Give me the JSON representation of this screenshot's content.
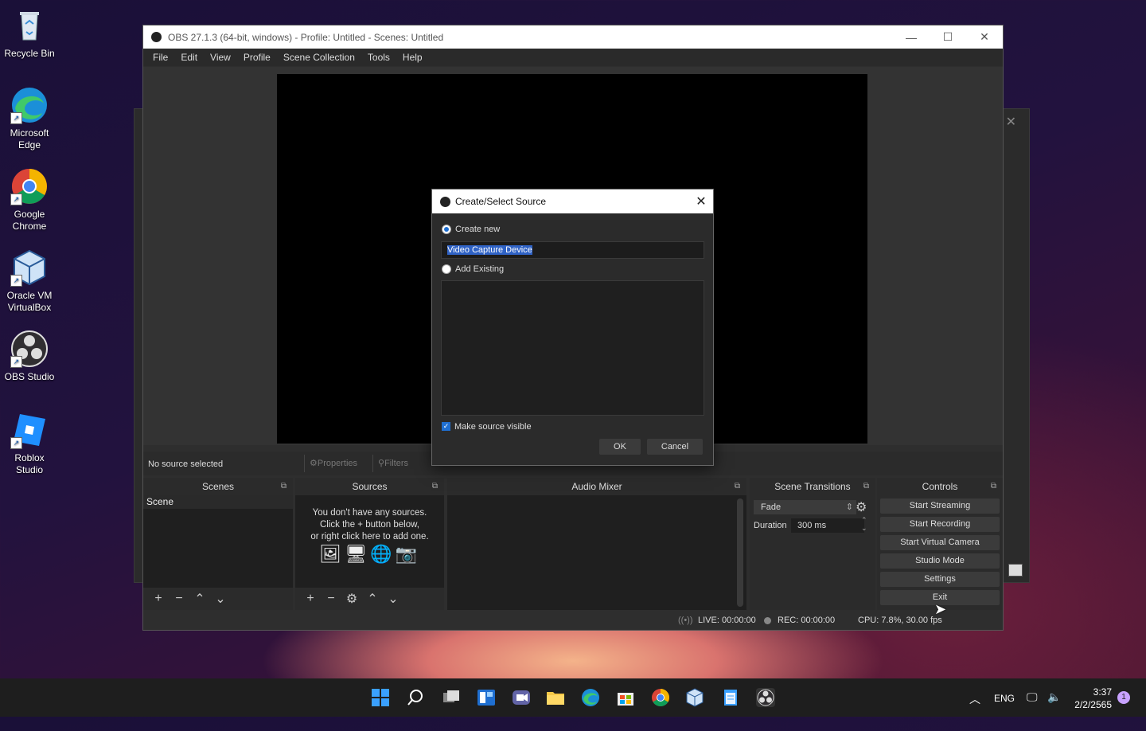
{
  "desktop": {
    "icons": [
      {
        "label": "Recycle Bin",
        "icon": "recycle-bin-icon"
      },
      {
        "label": "Microsoft Edge",
        "icon": "edge-icon"
      },
      {
        "label": "Google Chrome",
        "icon": "chrome-icon"
      },
      {
        "label": "Oracle VM VirtualBox",
        "icon": "virtualbox-icon"
      },
      {
        "label": "OBS Studio",
        "icon": "obs-icon"
      },
      {
        "label": "Roblox Studio",
        "icon": "roblox-studio-icon"
      }
    ]
  },
  "obs": {
    "title": "OBS 27.1.3 (64-bit, windows) - Profile: Untitled - Scenes: Untitled",
    "menu": [
      "File",
      "Edit",
      "View",
      "Profile",
      "Scene Collection",
      "Tools",
      "Help"
    ],
    "source_status": "No source selected",
    "properties_label": "Properties",
    "filters_label": "Filters",
    "docks": {
      "scenes": {
        "title": "Scenes",
        "items": [
          "Scene"
        ]
      },
      "sources": {
        "title": "Sources",
        "empty_line1": "You don't have any sources.",
        "empty_line2": "Click the + button below,",
        "empty_line3": "or right click here to add one."
      },
      "audio_mixer": {
        "title": "Audio Mixer"
      },
      "scene_transitions": {
        "title": "Scene Transitions",
        "transition": "Fade",
        "duration_label": "Duration",
        "duration_value": "300 ms"
      },
      "controls": {
        "title": "Controls",
        "buttons": [
          "Start Streaming",
          "Start Recording",
          "Start Virtual Camera",
          "Studio Mode",
          "Settings",
          "Exit"
        ]
      }
    },
    "status": {
      "live": "LIVE: 00:00:00",
      "rec": "REC: 00:00:00",
      "cpu": "CPU: 7.8%, 30.00 fps"
    }
  },
  "dialog": {
    "title": "Create/Select Source",
    "create_new_label": "Create new",
    "create_new_selected": true,
    "name_value": "Video Capture Device",
    "add_existing_label": "Add Existing",
    "make_visible_label": "Make source visible",
    "make_visible_checked": true,
    "ok_label": "OK",
    "cancel_label": "Cancel"
  },
  "taskbar": {
    "language": "ENG",
    "time": "3:37",
    "date": "2/2/2565",
    "notification_count": "1"
  }
}
